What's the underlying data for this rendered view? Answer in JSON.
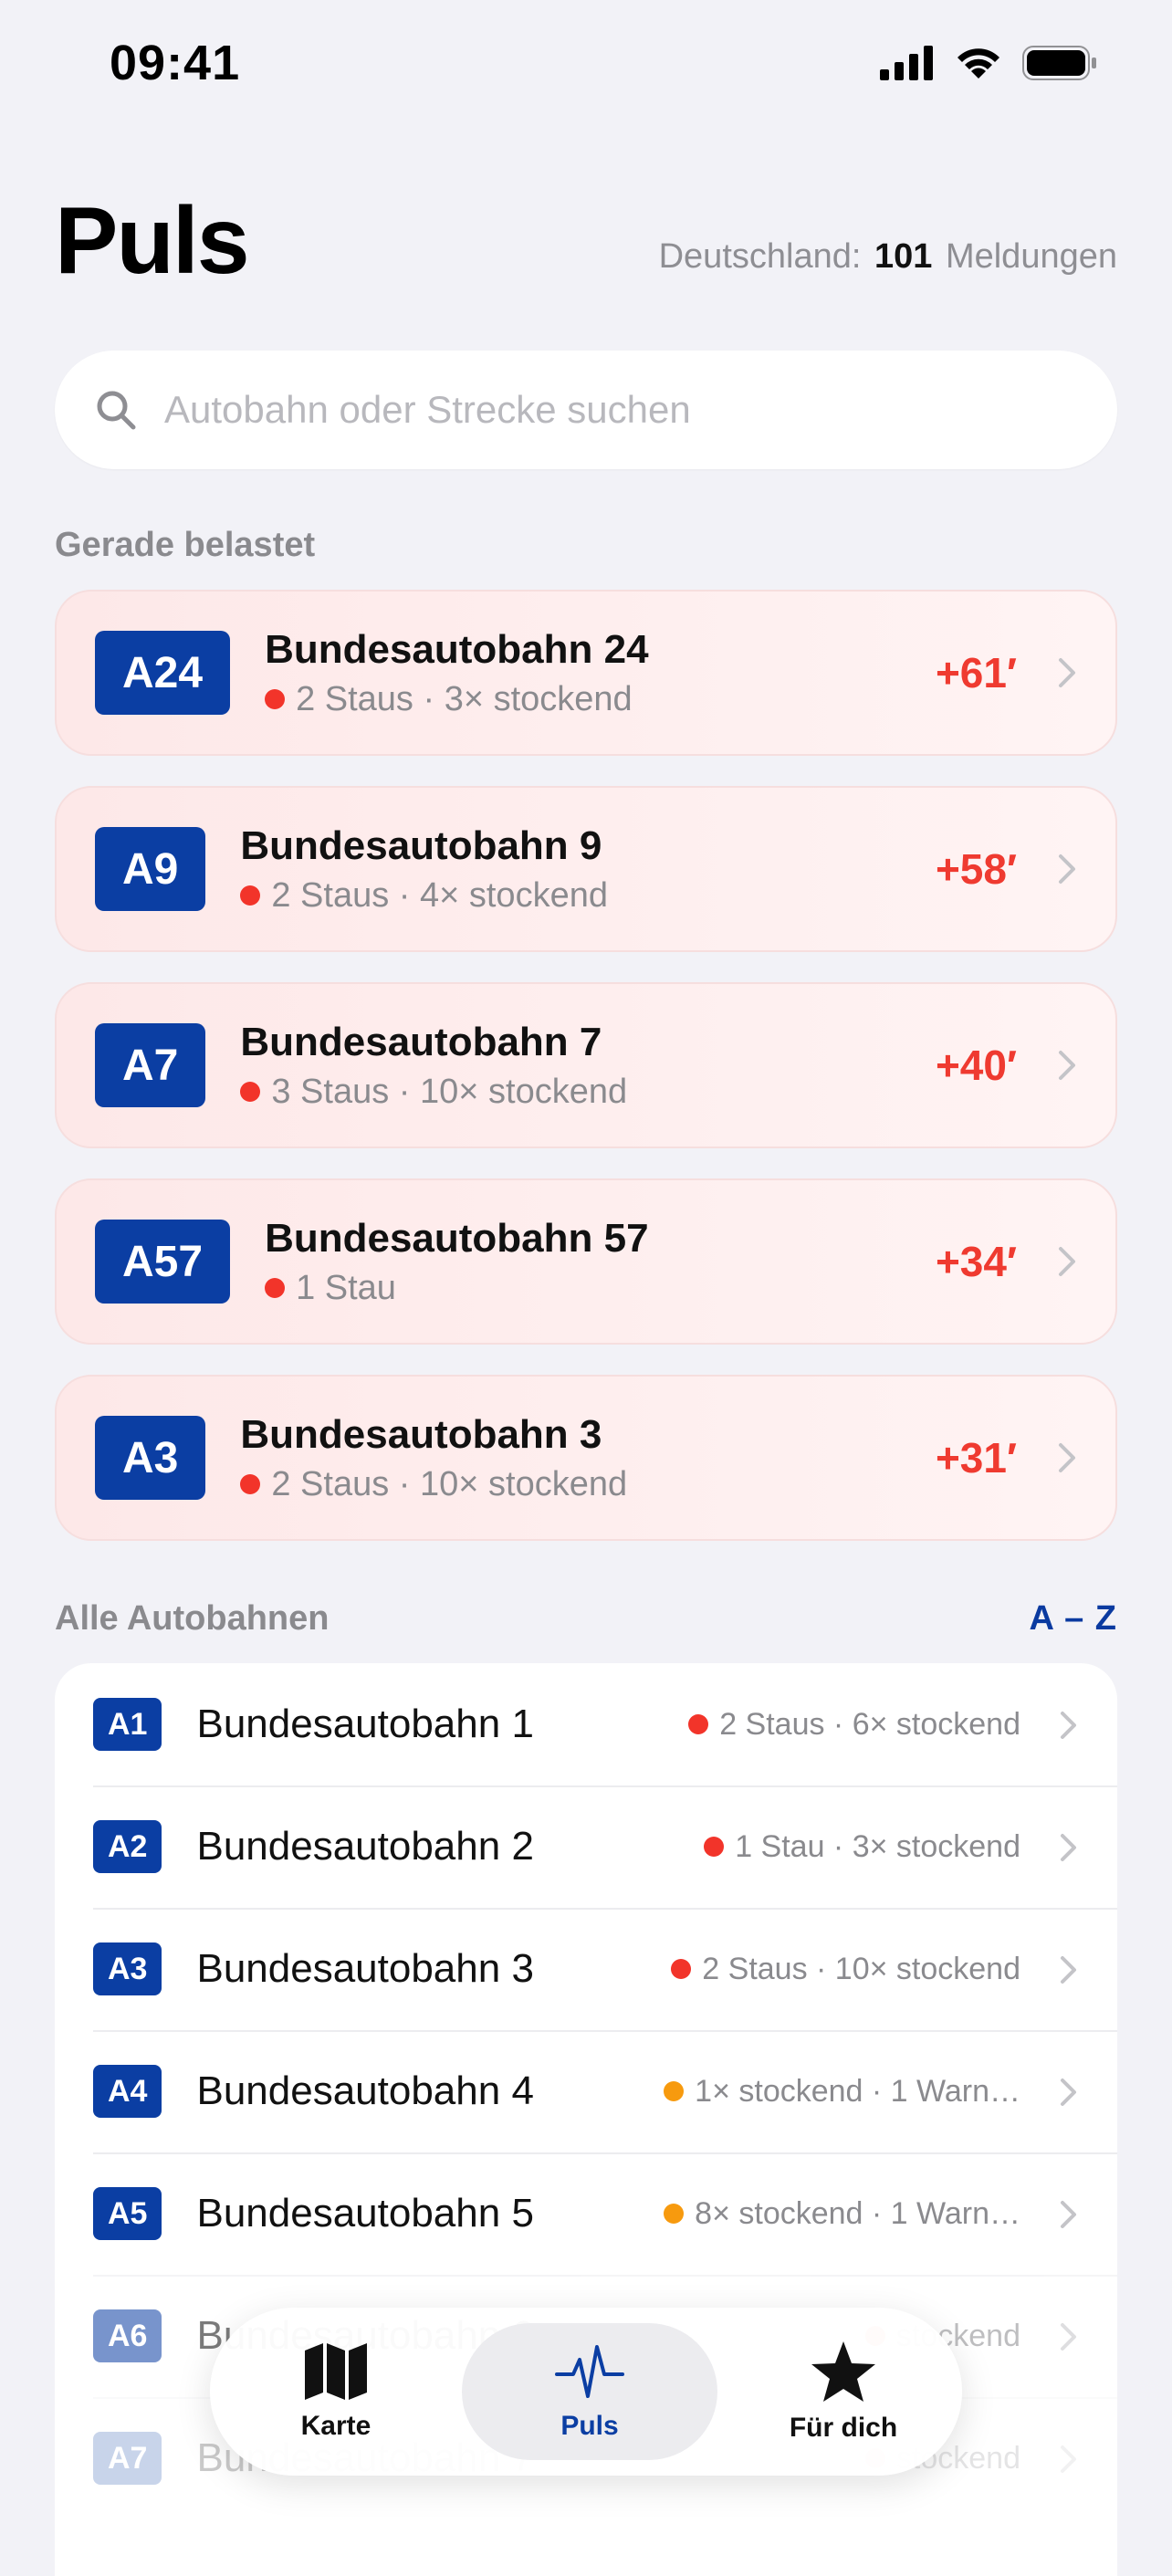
{
  "status_bar": {
    "time": "09:41"
  },
  "header": {
    "title": "Puls",
    "summary_prefix": "Deutschland:",
    "summary_count": "101",
    "summary_suffix": "Meldungen"
  },
  "search": {
    "placeholder": "Autobahn oder Strecke suchen",
    "value": ""
  },
  "hot_section": {
    "label": "Gerade belastet",
    "items": [
      {
        "badge": "A24",
        "name": "Bundesautobahn 24",
        "status": "2 Staus · 3× stockend",
        "delay": "+61′"
      },
      {
        "badge": "A9",
        "name": "Bundesautobahn 9",
        "status": "2 Staus · 4× stockend",
        "delay": "+58′"
      },
      {
        "badge": "A7",
        "name": "Bundesautobahn 7",
        "status": "3 Staus · 10× stockend",
        "delay": "+40′"
      },
      {
        "badge": "A57",
        "name": "Bundesautobahn 57",
        "status": "1 Stau",
        "delay": "+34′"
      },
      {
        "badge": "A3",
        "name": "Bundesautobahn 3",
        "status": "2 Staus · 10× stockend",
        "delay": "+31′"
      }
    ]
  },
  "all_section": {
    "label": "Alle Autobahnen",
    "sort_label": "A – Z",
    "items": [
      {
        "badge": "A1",
        "name": "Bundesautobahn 1",
        "status": "2 Staus · 6× stockend",
        "severity": "red"
      },
      {
        "badge": "A2",
        "name": "Bundesautobahn 2",
        "status": "1 Stau · 3× stockend",
        "severity": "red"
      },
      {
        "badge": "A3",
        "name": "Bundesautobahn 3",
        "status": "2 Staus · 10× stockend",
        "severity": "red"
      },
      {
        "badge": "A4",
        "name": "Bundesautobahn 4",
        "status": "1× stockend · 1 Warn…",
        "severity": "orange"
      },
      {
        "badge": "A5",
        "name": "Bundesautobahn 5",
        "status": "8× stockend · 1 Warn…",
        "severity": "orange"
      },
      {
        "badge": "A6",
        "name": "Bundesautobahn 6",
        "status": "stockend",
        "severity": "red"
      },
      {
        "badge": "A7",
        "name": "Bundesautobahn 7",
        "status": "stockend",
        "severity": "red"
      }
    ]
  },
  "tabbar": {
    "tabs": [
      {
        "label": "Karte",
        "icon": "map-icon"
      },
      {
        "label": "Puls",
        "icon": "pulse-icon",
        "active": true
      },
      {
        "label": "Für dich",
        "icon": "star-icon"
      }
    ]
  },
  "colors": {
    "accent": "#0b3ea3",
    "delay": "#ef3a30",
    "severity_red": "#f2342a",
    "severity_orange": "#f79a0e"
  }
}
